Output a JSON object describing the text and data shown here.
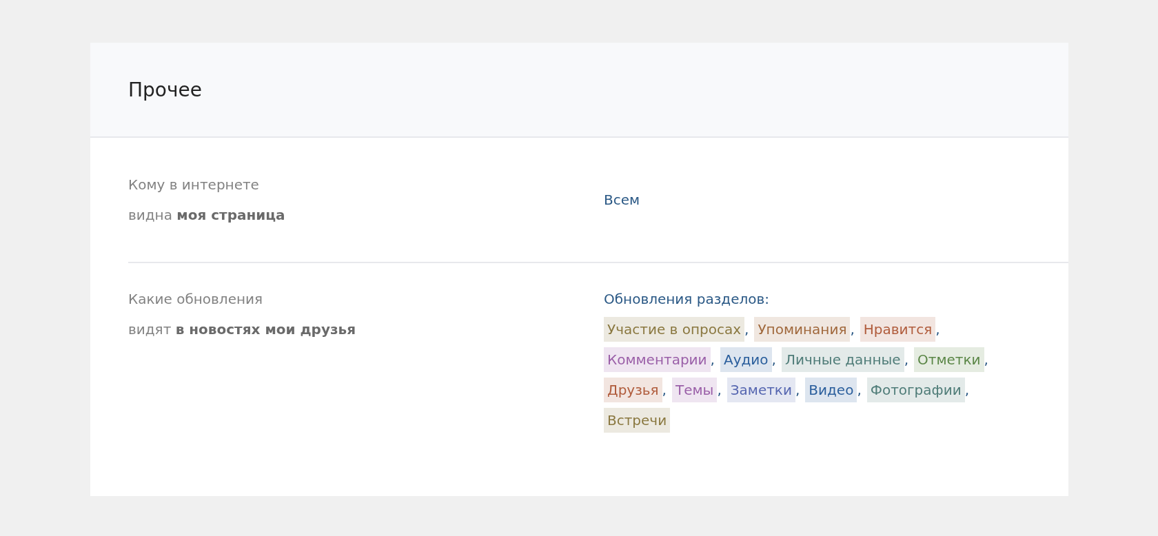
{
  "section": {
    "title": "Прочее"
  },
  "settings": [
    {
      "label": "Кому в интернете",
      "label_line2": "видна **моя страница**",
      "value": "Всем"
    },
    {
      "label": "Какие обновления",
      "label_line2": "видят **в новостях мои друзья**",
      "value": "Обновления разделов:",
      "tags": [
        {
          "text": "Участие в опросах",
          "color": "#8a7840",
          "separator": ","
        },
        {
          "text": "Упоминания",
          "color": "#a0683c",
          "separator": ","
        },
        {
          "text": "Нравится",
          "color": "#b05c3c",
          "separator": ","
        },
        {
          "text": "Комментарии",
          "color": "#9a5fa8",
          "separator": ","
        },
        {
          "text": "Аудио",
          "color": "#2a5e9c",
          "separator": ","
        },
        {
          "text": "Личные данные",
          "color": "#4f7c78",
          "separator": ","
        },
        {
          "text": "Отметки",
          "color": "#5a8646",
          "separator": ","
        },
        {
          "text": "Друзья",
          "color": "#b05c3c",
          "separator": ","
        },
        {
          "text": "Темы",
          "color": "#9a5fa8",
          "separator": ","
        },
        {
          "text": "Заметки",
          "color": "#5566b0",
          "separator": ","
        },
        {
          "text": "Видео",
          "color": "#2a5e9c",
          "separator": ","
        },
        {
          "text": "Фотографии",
          "color": "#4f7c78",
          "separator": ","
        },
        {
          "text": "Встречи",
          "color": "#8a7840"
        }
      ]
    }
  ]
}
